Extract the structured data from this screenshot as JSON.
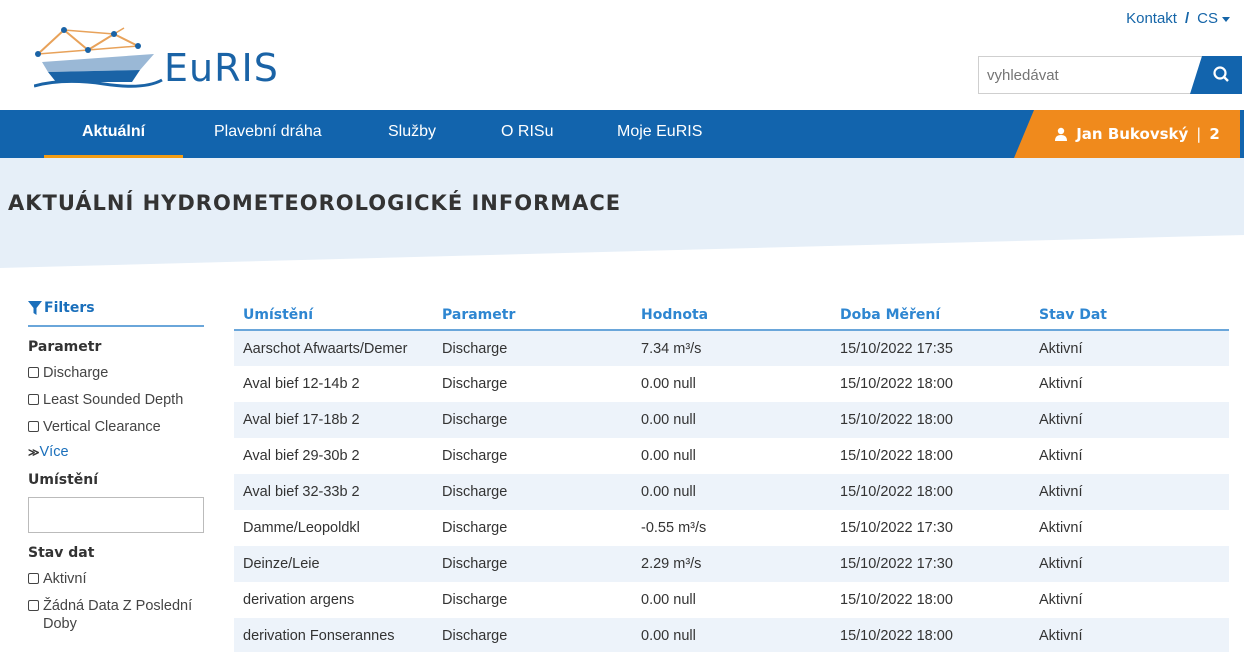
{
  "topbar": {
    "contact": "Kontakt",
    "separator": "/",
    "language": "CS"
  },
  "logo": {
    "text": "EuRIS"
  },
  "search": {
    "placeholder": "vyhledávat"
  },
  "nav": {
    "items": [
      {
        "label": "Aktuální",
        "active": true
      },
      {
        "label": "Plavební dráha",
        "active": false
      },
      {
        "label": "Služby",
        "active": false
      },
      {
        "label": "O RISu",
        "active": false
      },
      {
        "label": "Moje EuRIS",
        "active": false
      }
    ],
    "user": {
      "name": "Jan Bukovský",
      "separator": "|",
      "count": "2"
    }
  },
  "page": {
    "title": "AKTUÁLNÍ HYDROMETEOROLOGICKÉ INFORMACE"
  },
  "filters": {
    "title": "Filters",
    "parametr": {
      "heading": "Parametr",
      "options": [
        "Discharge",
        "Least Sounded Depth",
        "Vertical Clearance"
      ],
      "more": "Více"
    },
    "umisteni": {
      "heading": "Umístění",
      "value": ""
    },
    "stav": {
      "heading": "Stav dat",
      "options": [
        "Aktivní",
        "Žádná Data Z Poslední Doby"
      ]
    }
  },
  "table": {
    "headers": [
      "Umístění",
      "Parametr",
      "Hodnota",
      "Doba Měření",
      "Stav Dat"
    ],
    "rows": [
      [
        "Aarschot Afwaarts/Demer",
        "Discharge",
        "7.34 m³/s",
        "15/10/2022 17:35",
        "Aktivní"
      ],
      [
        "Aval bief 12-14b 2",
        "Discharge",
        "0.00 null",
        "15/10/2022 18:00",
        "Aktivní"
      ],
      [
        "Aval bief 17-18b 2",
        "Discharge",
        "0.00 null",
        "15/10/2022 18:00",
        "Aktivní"
      ],
      [
        "Aval bief 29-30b 2",
        "Discharge",
        "0.00 null",
        "15/10/2022 18:00",
        "Aktivní"
      ],
      [
        "Aval bief 32-33b 2",
        "Discharge",
        "0.00 null",
        "15/10/2022 18:00",
        "Aktivní"
      ],
      [
        "Damme/Leopoldkl",
        "Discharge",
        "-0.55 m³/s",
        "15/10/2022 17:30",
        "Aktivní"
      ],
      [
        "Deinze/Leie",
        "Discharge",
        "2.29 m³/s",
        "15/10/2022 17:30",
        "Aktivní"
      ],
      [
        "derivation argens",
        "Discharge",
        "0.00 null",
        "15/10/2022 18:00",
        "Aktivní"
      ],
      [
        "derivation Fonserannes",
        "Discharge",
        "0.00 null",
        "15/10/2022 18:00",
        "Aktivní"
      ]
    ]
  },
  "colors": {
    "primary": "#1264ad",
    "accent": "#f08a1c",
    "hero": "#e6eff8",
    "link": "#2e86d1"
  }
}
